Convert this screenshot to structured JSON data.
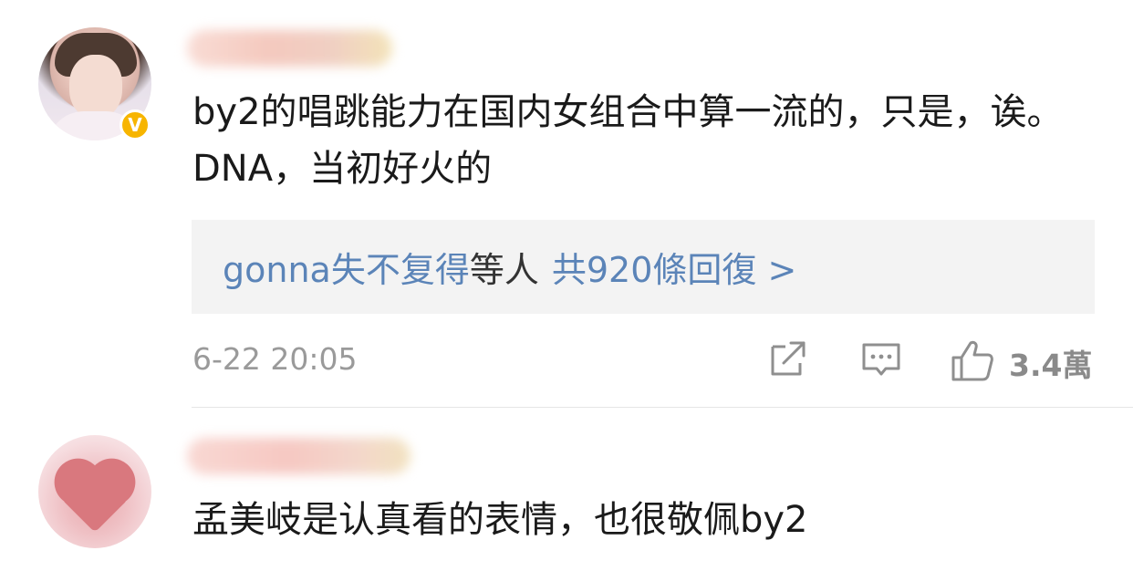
{
  "comments": [
    {
      "text": "by2的唱跳能力在国内女组合中算一流的，只是，诶。DNA，当初好火的",
      "replies": {
        "names": "gonna失不复得",
        "suffix": "等人",
        "count": "共920條回復 >"
      },
      "timestamp": "6-22 20:05",
      "likes": "3.4萬",
      "verified_badge": "V"
    },
    {
      "text": "孟美岐是认真看的表情，也很敬佩by2"
    }
  ],
  "icons": {
    "share": "share-icon",
    "comment": "comment-icon",
    "like": "thumbs-up-icon",
    "verified": "verified-icon"
  },
  "colors": {
    "link": "#5b84b8",
    "badge": "#f7b500",
    "reply_bg": "#f3f3f3",
    "meta": "#9a9a9a"
  }
}
